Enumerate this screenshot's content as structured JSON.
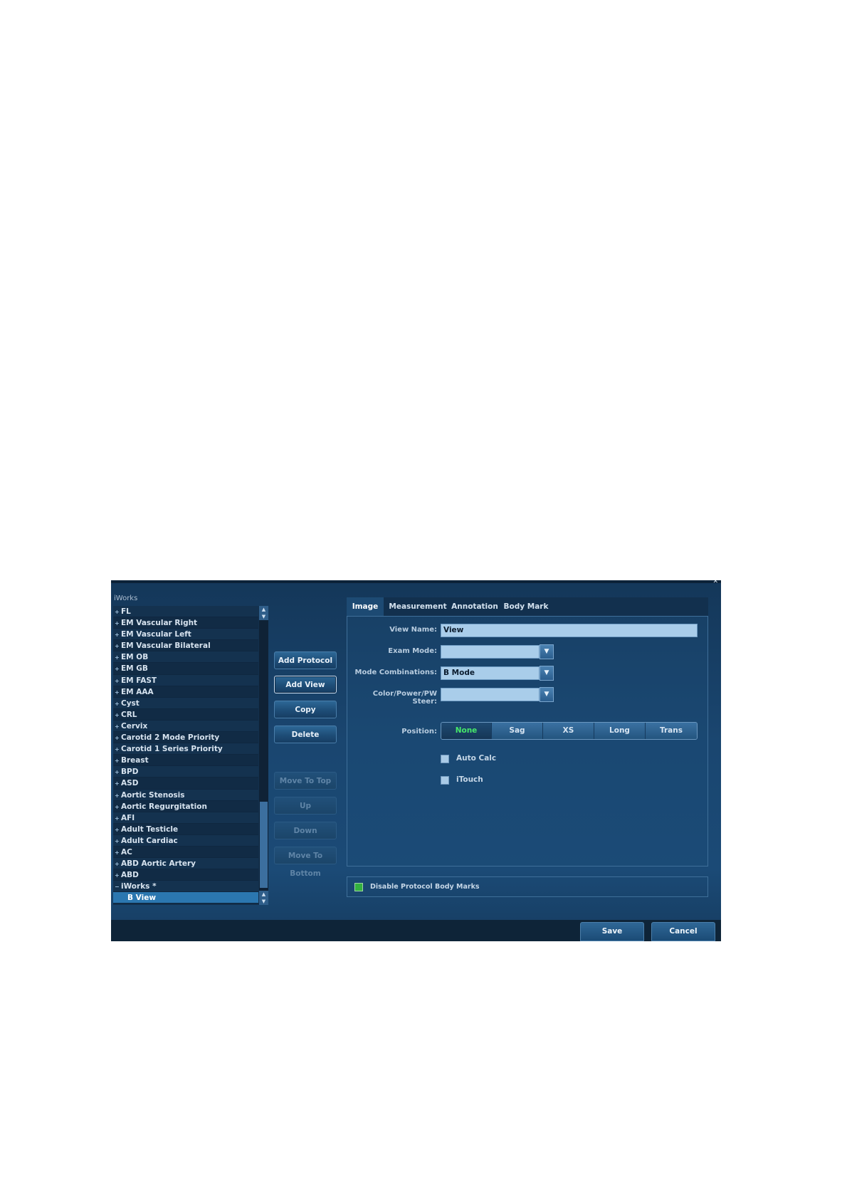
{
  "panel_title": "iWorks",
  "tree": {
    "items": [
      {
        "label": "FL",
        "expander": "+"
      },
      {
        "label": "EM Vascular Right",
        "expander": "+"
      },
      {
        "label": "EM Vascular Left",
        "expander": "+"
      },
      {
        "label": "EM Vascular Bilateral",
        "expander": "+"
      },
      {
        "label": "EM OB",
        "expander": "+"
      },
      {
        "label": "EM GB",
        "expander": "+"
      },
      {
        "label": "EM FAST",
        "expander": "+"
      },
      {
        "label": "EM AAA",
        "expander": "+"
      },
      {
        "label": "Cyst",
        "expander": "+"
      },
      {
        "label": "CRL",
        "expander": "+"
      },
      {
        "label": "Cervix",
        "expander": "+"
      },
      {
        "label": "Carotid 2 Mode Priority",
        "expander": "+"
      },
      {
        "label": "Carotid 1 Series Priority",
        "expander": "+"
      },
      {
        "label": "Breast",
        "expander": "+"
      },
      {
        "label": "BPD",
        "expander": "+"
      },
      {
        "label": "ASD",
        "expander": "+"
      },
      {
        "label": "Aortic Stenosis",
        "expander": "+"
      },
      {
        "label": "Aortic Regurgitation",
        "expander": "+"
      },
      {
        "label": "AFI",
        "expander": "+"
      },
      {
        "label": "Adult Testicle",
        "expander": "+"
      },
      {
        "label": "Adult Cardiac",
        "expander": "+"
      },
      {
        "label": "AC",
        "expander": "+"
      },
      {
        "label": "ABD Aortic Artery",
        "expander": "+"
      },
      {
        "label": "ABD",
        "expander": "+"
      },
      {
        "label": "iWorks *",
        "expander": "−"
      },
      {
        "label": "B View",
        "expander": "",
        "child": true,
        "selected": true
      }
    ]
  },
  "buttons": {
    "add_protocol": "Add Protocol",
    "add_view": "Add View",
    "copy": "Copy",
    "delete": "Delete",
    "move_to_top": "Move To Top",
    "up": "Up",
    "down": "Down",
    "move_to_bottom": "Move To Bottom"
  },
  "tabs": [
    "Image",
    "Measurement",
    "Annotation",
    "Body Mark"
  ],
  "form": {
    "view_name_label": "View Name:",
    "view_name_value": "View",
    "exam_mode_label": "Exam Mode:",
    "exam_mode_value": "",
    "mode_combinations_label": "Mode Combinations:",
    "mode_combinations_value": "B Mode",
    "steer_label": "Color/Power/PW Steer:",
    "steer_value": "",
    "position_label": "Position:",
    "positions": [
      "None",
      "Sag",
      "XS",
      "Long",
      "Trans"
    ],
    "position_selected": "None",
    "auto_calc_label": "Auto Calc",
    "itouch_label": "iTouch",
    "disable_body_marks_label": "Disable Protocol Body Marks"
  },
  "footer": {
    "save": "Save",
    "cancel": "Cancel"
  },
  "colors": {
    "dialog_bg": "#1a4670",
    "selected_row": "#2b77b0",
    "position_selected_text": "#46e86a",
    "body_marks_checkbox": "#33b23f"
  }
}
